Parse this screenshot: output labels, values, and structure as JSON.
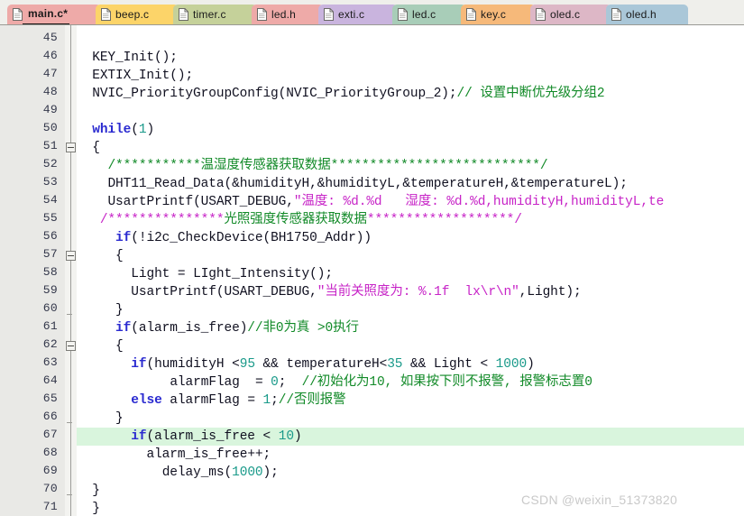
{
  "colors": {
    "keyword": "#2a2ad0",
    "comment": "#128a28",
    "string": "#c724c7",
    "number": "#1a9a8a",
    "plain": "#101020",
    "line_number": "#33374a",
    "current_line_highlight": "#d9f5dd",
    "gutter_bg": "#e9e9e6",
    "editor_bg": "#ffffff"
  },
  "tabs": [
    {
      "label": "main.c*",
      "active": true,
      "color": "#eeaaa8",
      "icon": "document-icon"
    },
    {
      "label": "beep.c",
      "active": false,
      "color": "#fcd469",
      "icon": "document-icon"
    },
    {
      "label": "timer.c",
      "active": false,
      "color": "#c5d19a",
      "icon": "document-icon"
    },
    {
      "label": "led.h",
      "active": false,
      "color": "#eeaaa8",
      "icon": "document-icon"
    },
    {
      "label": "exti.c",
      "active": false,
      "color": "#c9b4de",
      "icon": "document-icon"
    },
    {
      "label": "led.c",
      "active": false,
      "color": "#a8cdb8",
      "icon": "document-icon"
    },
    {
      "label": "key.c",
      "active": false,
      "color": "#f6b97a",
      "icon": "document-icon"
    },
    {
      "label": "oled.c",
      "active": false,
      "color": "#ddb7c6",
      "icon": "document-icon"
    },
    {
      "label": "oled.h",
      "active": false,
      "color": "#aac7d8",
      "icon": "document-icon"
    }
  ],
  "editor": {
    "first_line": 45,
    "last_line": 71,
    "highlighted_line": 67,
    "fold_open_lines": [
      51,
      57,
      62
    ],
    "fold_end_lines": [
      60,
      66,
      70
    ],
    "line_numbers": [
      45,
      46,
      47,
      48,
      49,
      50,
      51,
      52,
      53,
      54,
      55,
      56,
      57,
      58,
      59,
      60,
      61,
      62,
      63,
      64,
      65,
      66,
      67,
      68,
      69,
      70,
      71
    ],
    "lines": [
      {
        "n": 45,
        "text": ""
      },
      {
        "n": 46,
        "text": "  KEY_Init();"
      },
      {
        "n": 47,
        "text": "  EXTIX_Init();"
      },
      {
        "n": 48,
        "text": "  NVIC_PriorityGroupConfig(NVIC_PriorityGroup_2);// 设置中断优先级分组2"
      },
      {
        "n": 49,
        "text": ""
      },
      {
        "n": 50,
        "text": "  while(1)"
      },
      {
        "n": 51,
        "text": "  {"
      },
      {
        "n": 52,
        "text": "    /***********温湿度传感器获取数据***************************/"
      },
      {
        "n": 53,
        "text": "    DHT11_Read_Data(&humidityH,&humidityL,&temperatureH,&temperatureL);"
      },
      {
        "n": 54,
        "text": "    UsartPrintf(USART_DEBUG,\"温度: %d.%d   湿度: %d.%d,humidityH,humidityL,te"
      },
      {
        "n": 55,
        "text": "   /***************光照强度传感器获取数据*******************/"
      },
      {
        "n": 56,
        "text": "     if(!i2c_CheckDevice(BH1750_Addr))"
      },
      {
        "n": 57,
        "text": "     {"
      },
      {
        "n": 58,
        "text": "       Light = LIght_Intensity();"
      },
      {
        "n": 59,
        "text": "       UsartPrintf(USART_DEBUG,\"当前关照度为: %.1f  lx\\r\\n\",Light);"
      },
      {
        "n": 60,
        "text": "     }"
      },
      {
        "n": 61,
        "text": "     if(alarm_is_free)//非0为真 >0执行"
      },
      {
        "n": 62,
        "text": "     {"
      },
      {
        "n": 63,
        "text": "       if(humidityH <95 && temperatureH<35 && Light < 1000)"
      },
      {
        "n": 64,
        "text": "            alarmFlag  = 0;  //初始化为10, 如果按下则不报警, 报警标志置0"
      },
      {
        "n": 65,
        "text": "       else alarmFlag = 1;//否则报警"
      },
      {
        "n": 66,
        "text": "     }"
      },
      {
        "n": 67,
        "text": "       if(alarm_is_free < 10)"
      },
      {
        "n": 68,
        "text": "         alarm_is_free++;"
      },
      {
        "n": 69,
        "text": "           delay_ms(1000);"
      },
      {
        "n": 70,
        "text": "  }"
      },
      {
        "n": 71,
        "text": "  }"
      }
    ]
  },
  "watermark": {
    "text": "CSDN @weixin_51373820"
  }
}
